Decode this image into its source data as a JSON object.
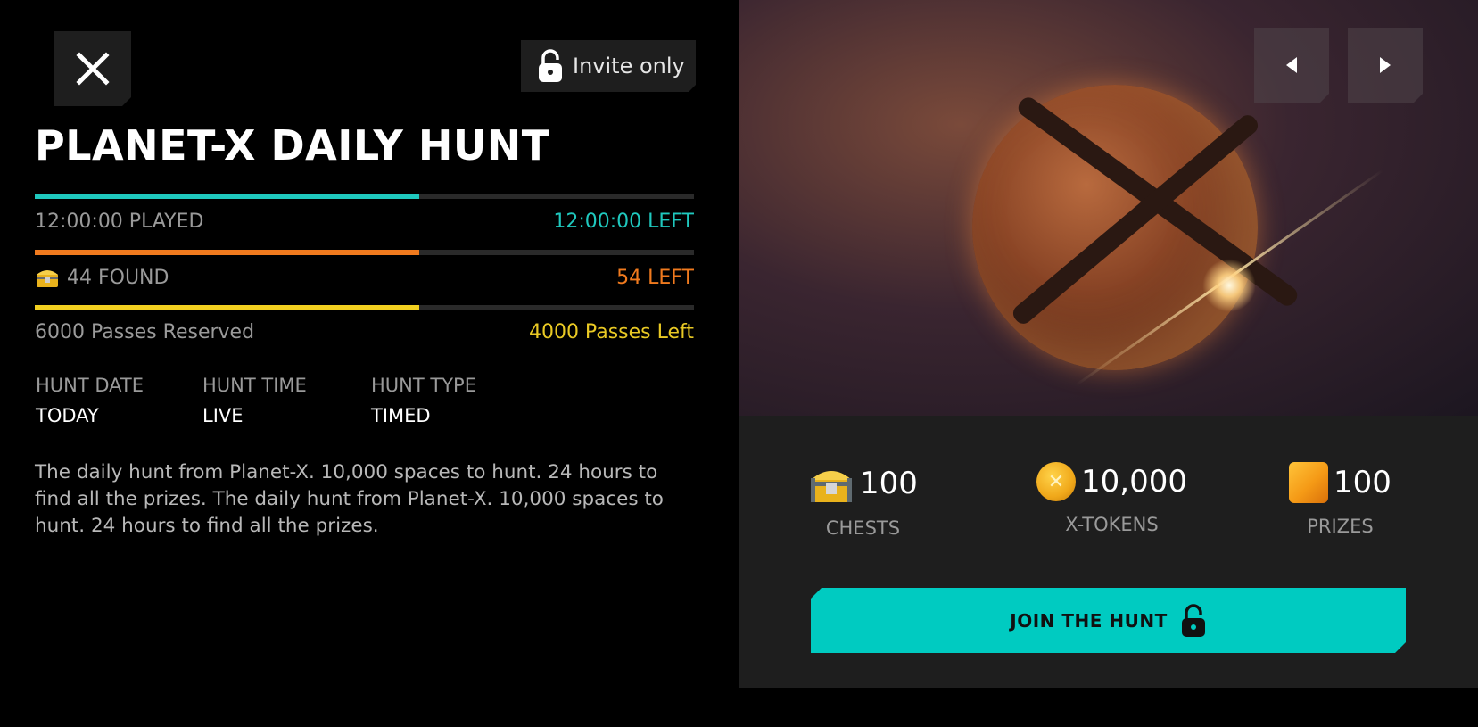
{
  "header": {
    "invite_label": "Invite only",
    "title": "PLANET-X DAILY HUNT"
  },
  "progress": {
    "time": {
      "played": "12:00:00 PLAYED",
      "left": "12:00:00 LEFT",
      "fraction": 0.583,
      "color": "#1fc8be"
    },
    "found": {
      "found": "44 FOUND",
      "left": "54 LEFT",
      "fraction": 0.583,
      "color": "#f07a1e"
    },
    "passes": {
      "reserved": "6000 Passes Reserved",
      "left": "4000 Passes Left",
      "fraction": 0.583,
      "color": "#f2d020"
    }
  },
  "meta": [
    {
      "label": "HUNT DATE",
      "value": "TODAY"
    },
    {
      "label": "HUNT TIME",
      "value": "LIVE"
    },
    {
      "label": "HUNT TYPE",
      "value": "TIMED"
    }
  ],
  "description": "The daily hunt from Planet-X. 10,000 spaces to hunt. 24 hours to find all the prizes. The daily hunt from Planet-X. 10,000 spaces to hunt. 24 hours to find all the prizes.",
  "rewards": [
    {
      "value": "100",
      "label": "CHESTS",
      "icon": "chest-icon"
    },
    {
      "value": "10,000",
      "label": "X-TOKENS",
      "icon": "x-token-icon"
    },
    {
      "value": "100",
      "label": "PRIZES",
      "icon": "prize-cube-icon"
    }
  ],
  "cta": {
    "label": "JOIN THE HUNT"
  },
  "colors": {
    "accent": "#00cbc1",
    "orange": "#f07a1e",
    "yellow": "#e9c924",
    "panel": "#1e1e1e"
  }
}
